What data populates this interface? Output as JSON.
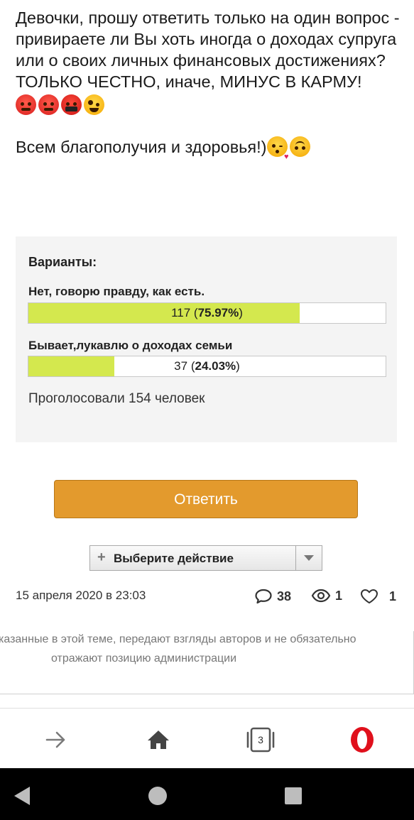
{
  "post": {
    "line1": "Девочки, прошу ответить только на один вопрос - привираете ли Вы хоть иногда о доходах супруга или о своих личных финансовых достижениях?",
    "line2": "ТОЛЬКО ЧЕСТНО, иначе, МИНУС В КАРМУ!",
    "line3": "Всем благополучия и здоровья!)",
    "emojis_row": [
      "angry-face",
      "pouting-face",
      "face-with-symbols-on-mouth",
      "zany-face"
    ],
    "emojis_end": [
      "face-blowing-kiss",
      "upside-down-face"
    ]
  },
  "poll": {
    "title": "Варианты:",
    "options": [
      {
        "label": "Нет, говорю правду, как есть.",
        "count": "117",
        "percent": "75.97%",
        "fraction": 0.7597
      },
      {
        "label": "Бывает,лукавлю о доходах семьи",
        "count": "37",
        "percent": "24.03%",
        "fraction": 0.2403
      }
    ],
    "total": "Проголосовали 154 человек",
    "bar_color": "#d4e84e"
  },
  "reply_button": "Ответить",
  "action_select": {
    "label": "Выберите действие",
    "plus": "+"
  },
  "meta": {
    "date": "15 апреля 2020 в 23:03",
    "comments": "38",
    "views": "1",
    "likes": "1"
  },
  "disclaimer": {
    "line1": "казанные в этой теме, передают взгляды авторов и не обязательно",
    "line2": "отражают позицию администрации"
  },
  "browser_bar": {
    "tabs_count": "3",
    "icons": [
      "forward-icon",
      "home-icon",
      "tabs-icon",
      "opera-icon"
    ]
  },
  "system_bar": {
    "icons": [
      "back-icon",
      "home-circle-icon",
      "recents-icon"
    ]
  },
  "colors": {
    "accent": "#e39a2d",
    "opera_red": "#e0101c"
  }
}
